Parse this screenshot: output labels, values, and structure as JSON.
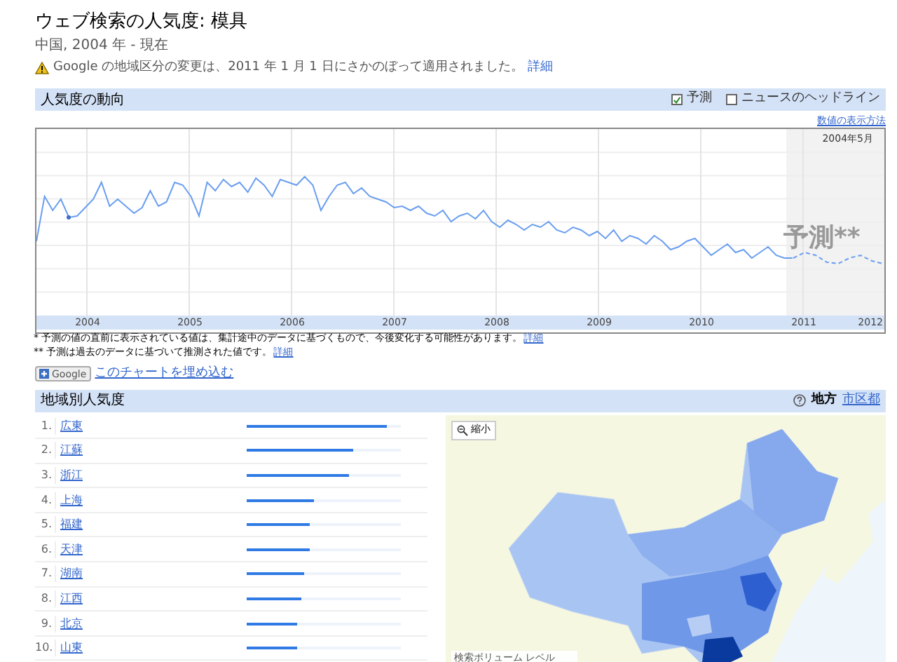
{
  "page": {
    "title": "ウェブ検索の人気度: 模具",
    "subtitle": "中国, 2004 年 - 現在",
    "notice": "Google の地域区分の変更は、2011 年 1 月 1 日にさかのぼって適用されました。",
    "notice_link": "詳細"
  },
  "trend": {
    "header": "人気度の動向",
    "options": [
      {
        "label": "予測",
        "checked": true
      },
      {
        "label": "ニュースのヘッドライン",
        "checked": false
      }
    ],
    "help_link": "数値の表示方法",
    "date_label": "2004年5月",
    "forecast_label": "予測**",
    "years": [
      "2004",
      "2005",
      "2006",
      "2007",
      "2008",
      "2009",
      "2010",
      "2011",
      "2012"
    ],
    "footnotes": [
      {
        "text": "* 予測の値の直前に表示されている値は、集計途中のデータに基づくもので、今後変化する可能性があります。",
        "link": "詳細"
      },
      {
        "text": "** 予測は過去のデータに基づいて推測された値です。",
        "link": "詳細"
      }
    ],
    "embed_button": "Google",
    "embed_link": "このチャートを埋め込む"
  },
  "regions": {
    "header": "地域別人気度",
    "scope_label": "地方",
    "scope_link": "市区都",
    "rows": [
      {
        "rank": "1.",
        "name": "広東",
        "level": 0.91
      },
      {
        "rank": "2.",
        "name": "江蘇",
        "level": 0.69
      },
      {
        "rank": "3.",
        "name": "浙江",
        "level": 0.66
      },
      {
        "rank": "4.",
        "name": "上海",
        "level": 0.44
      },
      {
        "rank": "5.",
        "name": "福建",
        "level": 0.41
      },
      {
        "rank": "6.",
        "name": "天津",
        "level": 0.41
      },
      {
        "rank": "7.",
        "name": "湖南",
        "level": 0.37
      },
      {
        "rank": "8.",
        "name": "江西",
        "level": 0.35
      },
      {
        "rank": "9.",
        "name": "北京",
        "level": 0.33
      },
      {
        "rank": "10.",
        "name": "山東",
        "level": 0.33
      }
    ],
    "map": {
      "kind": "picture",
      "zoom_button": "縮小",
      "legend_title": "検索ボリューム レベル"
    }
  }
}
